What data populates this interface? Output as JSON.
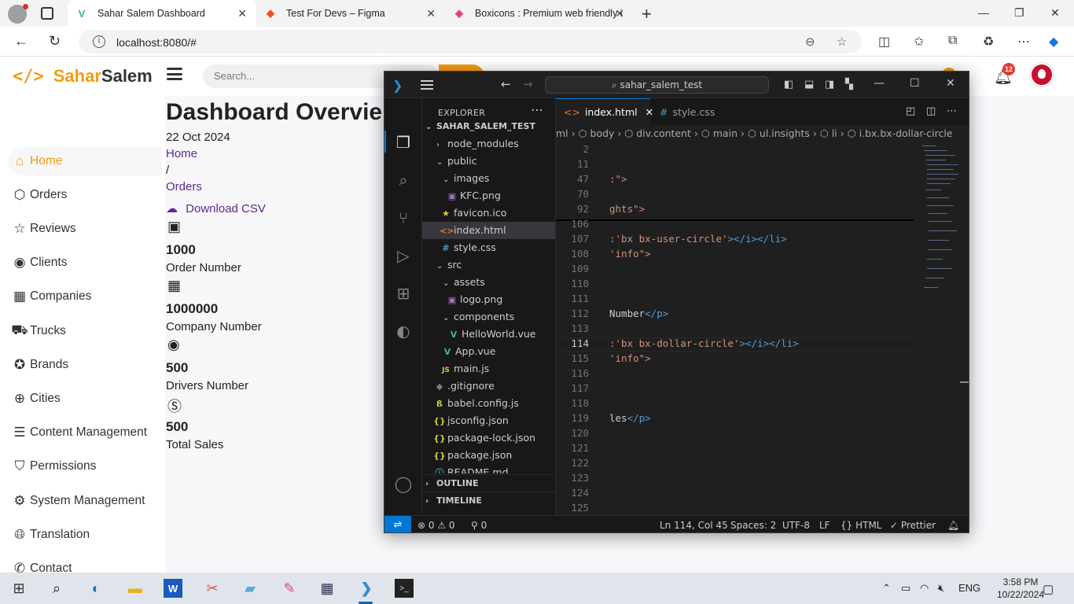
{
  "browser": {
    "tabs": [
      {
        "title": "Sahar Salem Dashboard",
        "active": true
      },
      {
        "title": "Test For Devs – Figma",
        "active": false
      },
      {
        "title": "Boxicons : Premium web friendly i",
        "active": false
      }
    ],
    "url": "localhost:8080/#"
  },
  "app": {
    "logo_part1": "Sahar",
    "logo_part2": "Salem",
    "search_placeholder": "Search...",
    "notifications_count": "12"
  },
  "sidebar": {
    "items": [
      {
        "label": "Home",
        "icon": "home-icon",
        "active": true
      },
      {
        "label": "Orders",
        "icon": "cube-icon"
      },
      {
        "label": "Reviews",
        "icon": "star-icon"
      },
      {
        "label": "Clients",
        "icon": "user-circle-icon"
      },
      {
        "label": "Companies",
        "icon": "buildings-icon"
      },
      {
        "label": "Trucks",
        "icon": "truck-icon"
      },
      {
        "label": "Brands",
        "icon": "medal-icon"
      },
      {
        "label": "Cities",
        "icon": "globe-icon"
      },
      {
        "label": "Content Management",
        "icon": "list-icon"
      },
      {
        "label": "Permissions",
        "icon": "shield-icon"
      },
      {
        "label": "System Management",
        "icon": "cog-icon"
      },
      {
        "label": "Translation",
        "icon": "world-icon"
      },
      {
        "label": "Contact",
        "icon": "contact-icon"
      }
    ]
  },
  "main": {
    "title": "Dashboard Overvie",
    "date": "22 Oct 2024",
    "breadcrumb_home": "Home",
    "breadcrumb_sep": "/",
    "breadcrumb_orders": "Orders",
    "download": "Download CSV",
    "insights": [
      {
        "value": "1000",
        "label": "Order Number",
        "icon": "calendar-check-icon"
      },
      {
        "value": "1000000",
        "label": "Company Number",
        "icon": "building-icon"
      },
      {
        "value": "500",
        "label": "Drivers Number",
        "icon": "user-circle-icon"
      },
      {
        "value": "500",
        "label": "Total Sales",
        "icon": "dollar-circle-icon"
      }
    ]
  },
  "vscode": {
    "command_center": "sahar_salem_test",
    "explorer_title": "EXPLORER",
    "project": "SAHAR_SALEM_TEST",
    "tree": [
      {
        "name": "node_modules"
      },
      {
        "name": "public"
      },
      {
        "name": "images"
      },
      {
        "name": "KFC.png"
      },
      {
        "name": "favicon.ico"
      },
      {
        "name": "index.html"
      },
      {
        "name": "style.css"
      },
      {
        "name": "src"
      },
      {
        "name": "assets"
      },
      {
        "name": "logo.png"
      },
      {
        "name": "components"
      },
      {
        "name": "HelloWorld.vue"
      },
      {
        "name": "App.vue"
      },
      {
        "name": "main.js"
      },
      {
        "name": ".gitignore"
      },
      {
        "name": "babel.config.js"
      },
      {
        "name": "jsconfig.json"
      },
      {
        "name": "package-lock.json"
      },
      {
        "name": "package.json"
      },
      {
        "name": "README.md"
      }
    ],
    "outline": "OUTLINE",
    "timeline": "TIMELINE",
    "editor_tabs": [
      "index.html",
      "style.css"
    ],
    "breadcrumbs": [
      "ml",
      "body",
      "div.content",
      "main",
      "ul.insights",
      "li",
      "i.bx.bx-dollar-circle"
    ],
    "line_numbers": [
      "2",
      "11",
      "47",
      "70",
      "92",
      "106",
      "107",
      "108",
      "109",
      "110",
      "111",
      "112",
      "113",
      "114",
      "115",
      "116",
      "117",
      "118",
      "119",
      "120",
      "121",
      "122",
      "123",
      "124",
      "125"
    ],
    "code": {
      "l47": ":\">",
      "l92": "ghts\">",
      "l107_str": ":'bx bx-user-circle'",
      "l107_end": "></i></li>",
      "l108": "'info\">",
      "l112_txt": "Number",
      "l112_end": "</p>",
      "l114_str": ":'bx bx-dollar-circle'",
      "l114_end": "></i></li>",
      "l115": "'info\">",
      "l119_txt": "les",
      "l119_end": "</p>"
    },
    "status": {
      "problems": "⊗ 0 ⚠ 0",
      "ports": "0",
      "position": "Ln 114, Col 45",
      "spaces": "Spaces: 2",
      "encoding": "UTF-8",
      "eol": "LF",
      "language": "HTML",
      "formatter": "Prettier"
    }
  },
  "taskbar": {
    "language": "ENG",
    "time": "3:58 PM",
    "date": "10/22/2024"
  }
}
